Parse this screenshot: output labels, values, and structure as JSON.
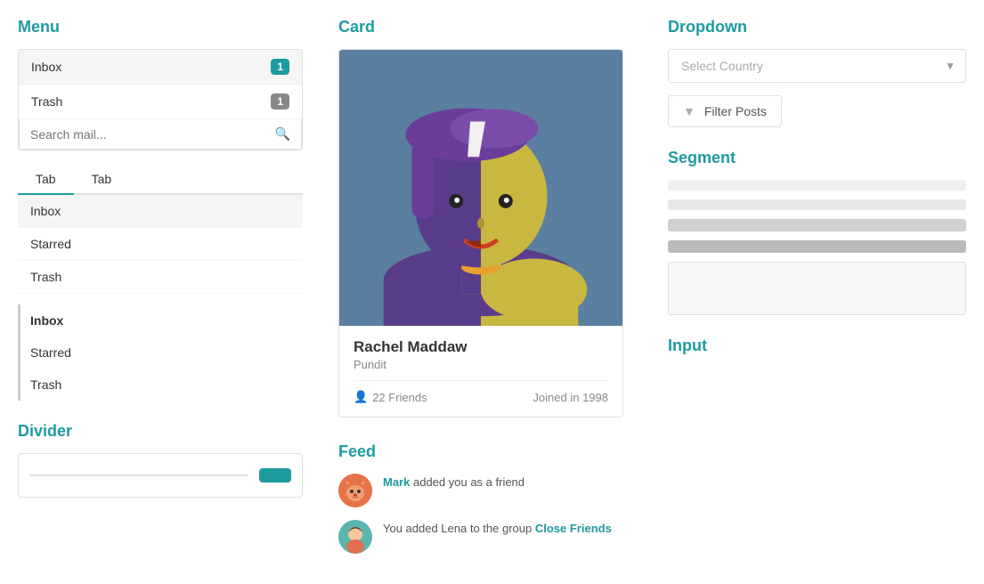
{
  "menu": {
    "title": "Menu",
    "items": [
      {
        "label": "Inbox",
        "badge": "1",
        "badgeType": "teal",
        "active": true
      },
      {
        "label": "Trash",
        "badge": "1",
        "badgeType": "gray"
      }
    ],
    "search_placeholder": "Search mail...",
    "tabs": [
      {
        "label": "Tab",
        "active": true
      },
      {
        "label": "Tab",
        "active": false
      }
    ],
    "tab_list": [
      {
        "label": "Inbox",
        "active": true
      },
      {
        "label": "Starred"
      },
      {
        "label": "Trash"
      }
    ],
    "bordered_list": [
      {
        "label": "Inbox",
        "bold": true
      },
      {
        "label": "Starred"
      },
      {
        "label": "Trash"
      }
    ]
  },
  "divider": {
    "title": "Divider",
    "button_label": ""
  },
  "card": {
    "title": "Card",
    "name": "Rachel Maddaw",
    "role": "Pundit",
    "friends_count": "22 Friends",
    "joined": "Joined in 1998"
  },
  "feed": {
    "title": "Feed",
    "items": [
      {
        "user": "Mark",
        "text": "added you as a friend",
        "avatar_type": "fox"
      },
      {
        "prefix": "You added Lena to the group",
        "link": "Close Friends",
        "avatar_type": "person"
      }
    ]
  },
  "dropdown": {
    "title": "Dropdown",
    "placeholder": "Select Country",
    "filter_button": "Filter Posts"
  },
  "segment": {
    "title": "Segment"
  },
  "input": {
    "title": "Input"
  },
  "icons": {
    "search": "🔍",
    "friends": "👤",
    "filter": "▼",
    "funnel": "⊿"
  }
}
